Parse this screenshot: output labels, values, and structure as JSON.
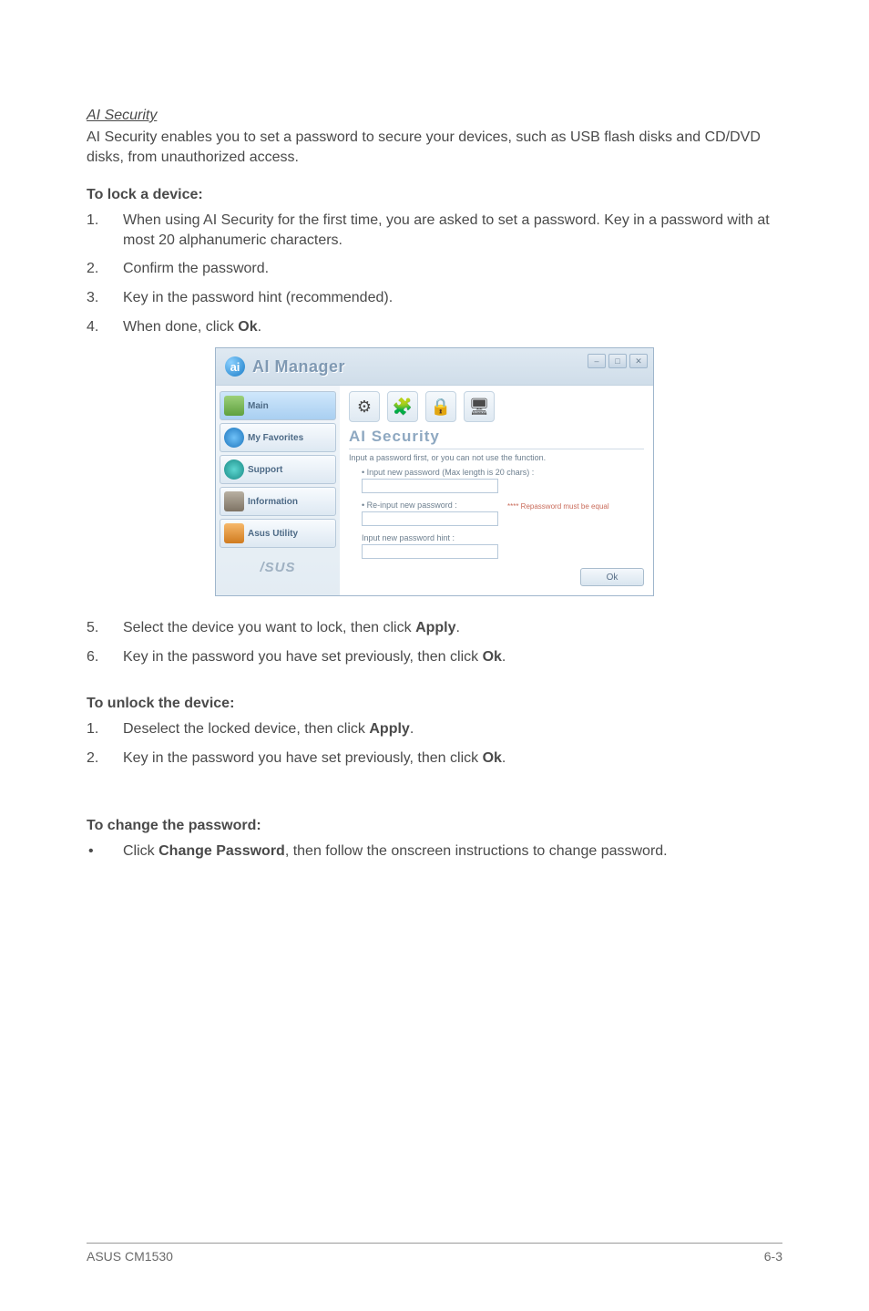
{
  "section_title": "AI Security",
  "intro": "AI Security enables you to set a password to secure your devices, such as USB flash disks and CD/DVD disks, from unauthorized access.",
  "lock": {
    "heading": "To lock a device:",
    "steps": [
      "When using AI Security for the first time, you are asked to set a password. Key in a password with at most 20 alphanumeric characters.",
      "Confirm the password.",
      "Key in the password hint (recommended).",
      "When done, click <b>Ok</b>."
    ],
    "steps_after": [
      "Select the device you want to lock, then click <b>Apply</b>.",
      "Key in the password you have set previously, then click <b>Ok</b>."
    ]
  },
  "unlock": {
    "heading": "To unlock the device:",
    "steps": [
      "Deselect the locked device, then click <b>Apply</b>.",
      "Key in the password you have set previously, then click <b>Ok</b>."
    ]
  },
  "change": {
    "heading": "To change the password:",
    "bullet": "Click <b>Change Password</b>, then follow the onscreen instructions to change password."
  },
  "aim": {
    "title": "AI Manager",
    "sidebar": [
      "Main",
      "My Favorites",
      "Support",
      "Information",
      "Asus Utility"
    ],
    "brand": "/SUS",
    "tool_icons": [
      "⚙",
      "🧩",
      "🔒",
      "🖥"
    ],
    "panel_title": "AI Security",
    "panel_desc": "Input a password first, or you can not use the function.",
    "f1": "Input new password (Max length is 20 chars) :",
    "f2": "Re-input new password :",
    "note": "**** Repassword must be equal",
    "f3": "Input new password hint :",
    "ok": "Ok"
  },
  "footer": {
    "left": "ASUS CM1530",
    "right": "6-3"
  }
}
